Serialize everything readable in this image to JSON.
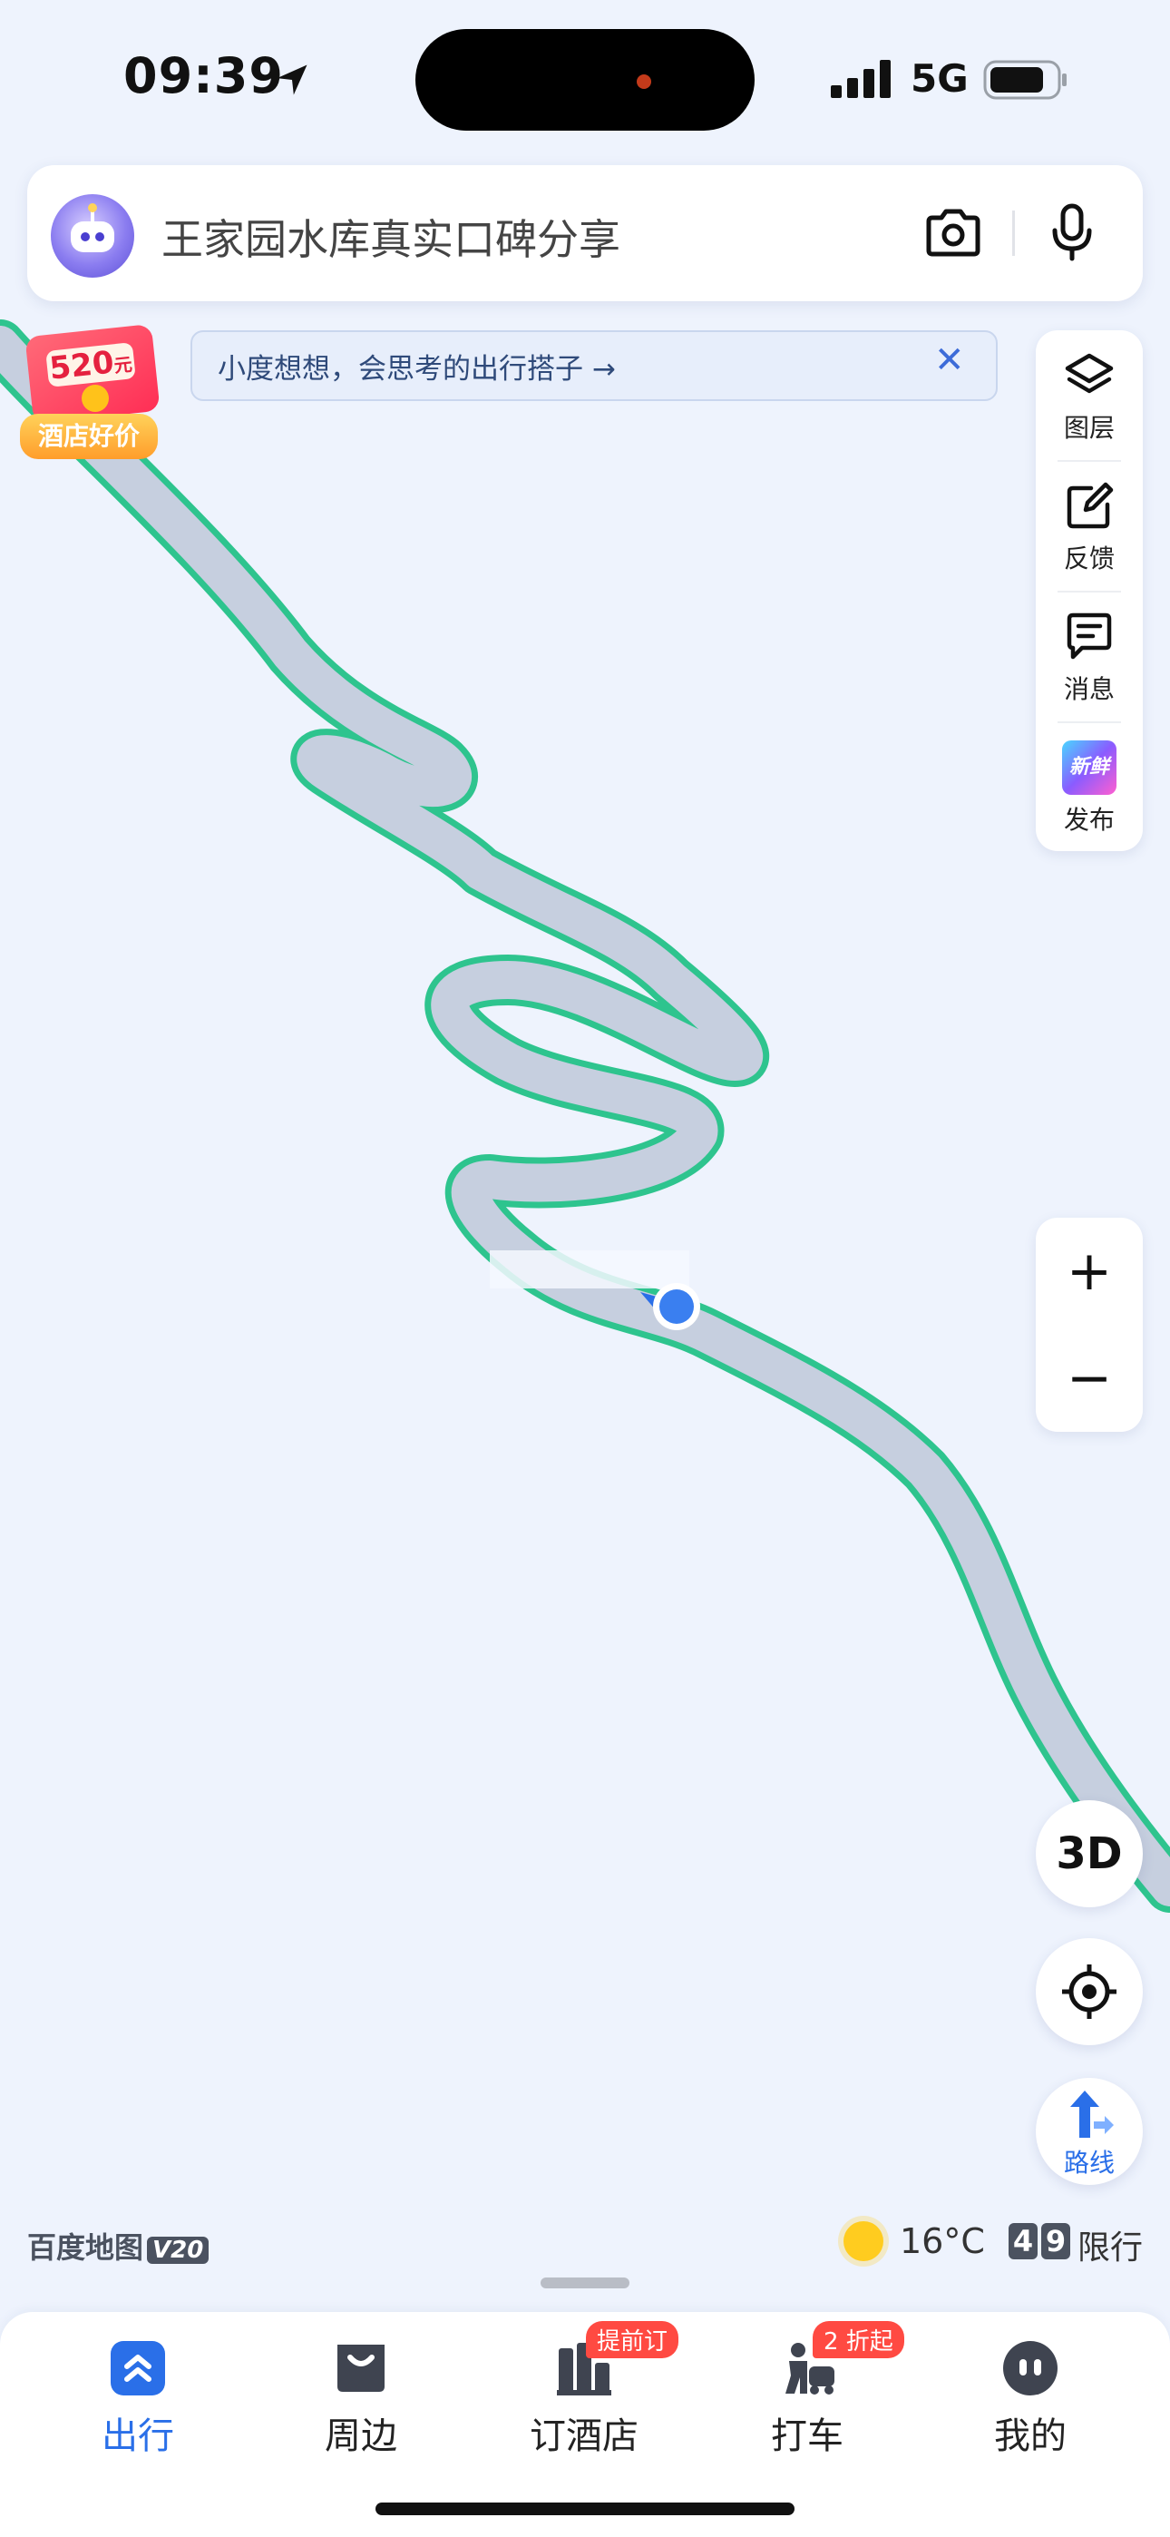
{
  "status_bar": {
    "time": "09:39",
    "network": "5G",
    "icons": [
      "location-arrow-icon",
      "signal-icon",
      "battery-icon"
    ]
  },
  "search": {
    "placeholder": "王家园水库真实口碑分享",
    "icons": [
      "assistant-avatar-icon",
      "camera-icon",
      "microphone-icon"
    ]
  },
  "notice": {
    "text": "小度想想，会思考的出行搭子 →",
    "close_icon": "close-icon"
  },
  "promo": {
    "amount": "520",
    "unit": "元",
    "label": "酒店好价"
  },
  "tools": [
    {
      "label": "图层",
      "icon": "layers-icon"
    },
    {
      "label": "反馈",
      "icon": "edit-icon"
    },
    {
      "label": "消息",
      "icon": "message-icon"
    },
    {
      "label": "发布",
      "icon": "new-post-icon",
      "icon_text": "新鲜事"
    }
  ],
  "zoom": {
    "in": "+",
    "out": "−"
  },
  "controls": {
    "three_d": "3D",
    "locate_icon": "locate-icon",
    "route_label": "路线"
  },
  "brand": {
    "name": "百度地图",
    "version": "V20"
  },
  "weather": {
    "temperature": "16°C",
    "icon": "sun-icon"
  },
  "traffic_limit": {
    "digits": [
      "4",
      "9"
    ],
    "label": "限行"
  },
  "tabs": [
    {
      "label": "出行",
      "icon": "travel-icon",
      "active": true,
      "badge": ""
    },
    {
      "label": "周边",
      "icon": "nearby-bag-icon",
      "active": false,
      "badge": ""
    },
    {
      "label": "订酒店",
      "icon": "hotel-icon",
      "active": false,
      "badge": "提前订"
    },
    {
      "label": "打车",
      "icon": "taxi-icon",
      "active": false,
      "badge": "2 折起"
    },
    {
      "label": "我的",
      "icon": "profile-icon",
      "active": false,
      "badge": ""
    }
  ],
  "colors": {
    "map_background": "#eef3fd",
    "route_outline": "#2ec48e",
    "road_fill": "#c6cfdf",
    "accent_blue": "#2a6fe8",
    "badge_red": "#ff4a42"
  }
}
